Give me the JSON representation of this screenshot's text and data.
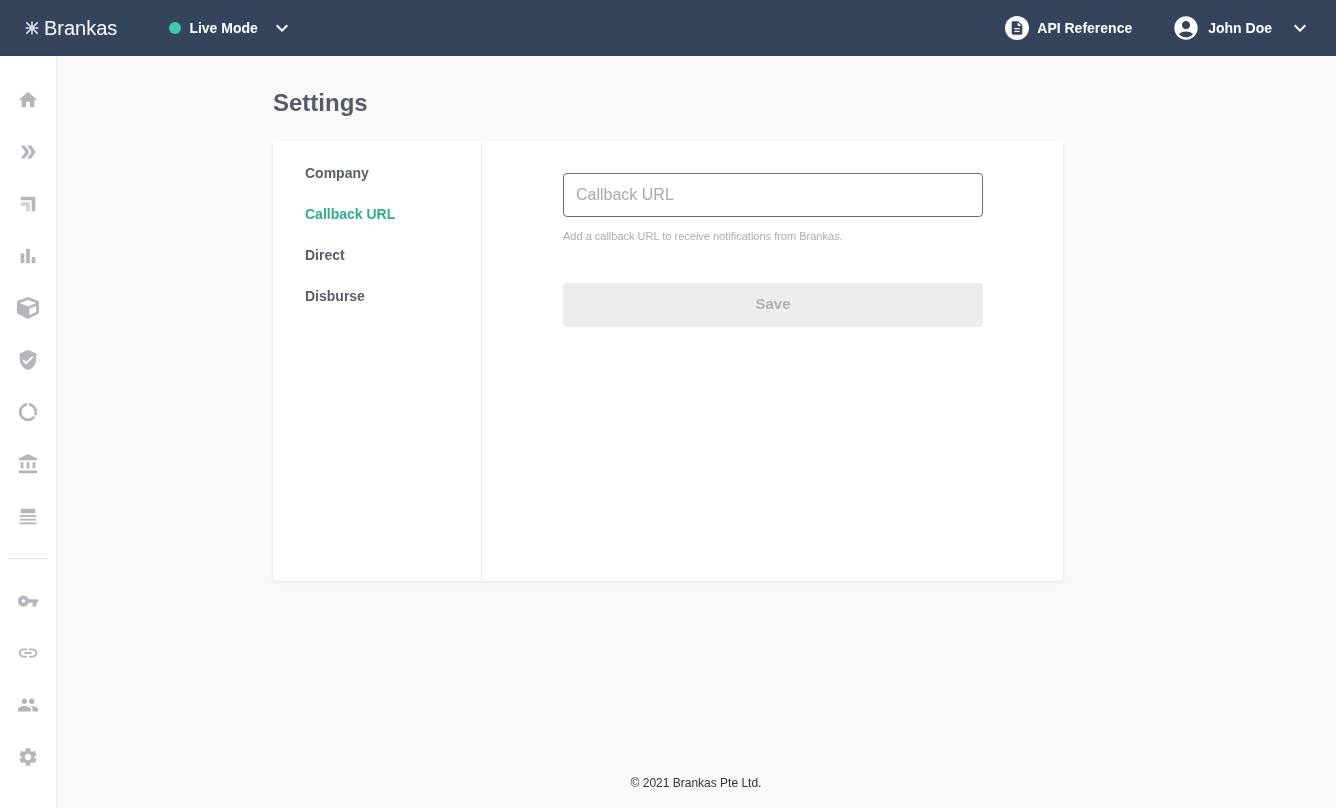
{
  "topbar": {
    "brand": "Brankas",
    "mode": {
      "label": "Live Mode",
      "color": "#3ecba5"
    },
    "api_reference": "API Reference",
    "user": "John Doe"
  },
  "page": {
    "title": "Settings"
  },
  "settings_nav": [
    {
      "label": "Company",
      "selected": false
    },
    {
      "label": "Callback URL",
      "selected": true
    },
    {
      "label": "Direct",
      "selected": false
    },
    {
      "label": "Disburse",
      "selected": false
    }
  ],
  "form": {
    "field": {
      "placeholder": "Callback URL"
    },
    "hint": "Add a callback URL to receive notifications from Brankas.",
    "save": {
      "label": "Save",
      "disabled": true
    }
  },
  "footer": "© 2021 Brankas Pte Ltd."
}
